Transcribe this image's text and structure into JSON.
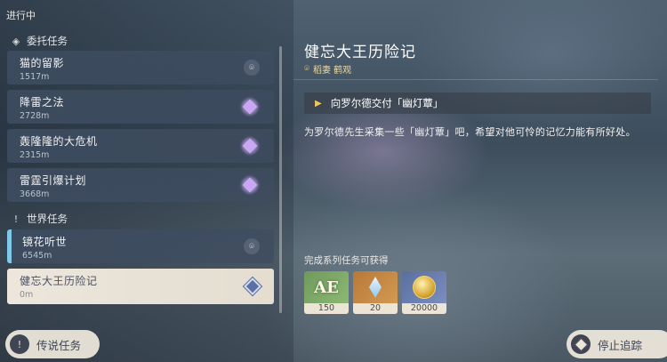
{
  "status_label": "进行中",
  "sections": {
    "commission": "委托任务",
    "world": "世界任务"
  },
  "quests": [
    {
      "name": "猫的留影",
      "distance": "1517m",
      "icon": "map-pin-icon"
    },
    {
      "name": "降雷之法",
      "distance": "2728m",
      "icon": "purple-star-icon"
    },
    {
      "name": "轰隆隆的大危机",
      "distance": "2315m",
      "icon": "purple-star-icon"
    },
    {
      "name": "雷霆引爆计划",
      "distance": "3668m",
      "icon": "purple-star-icon"
    },
    {
      "name": "镜花听世",
      "distance": "6545m",
      "icon": "map-pin-icon"
    },
    {
      "name": "健忘大王历险记",
      "distance": "0m",
      "icon": "tracked-diamond-icon"
    }
  ],
  "detail": {
    "title": "健忘大王历险记",
    "location": "稻妻 鹤观",
    "objective": "向罗尔德交付「幽灯蕈」",
    "description": "为罗尔德先生采集一些「幽灯蕈」吧，希望对他可怜的记忆力能有所好处。",
    "rewards_label": "完成系列任务可获得",
    "rewards": [
      {
        "name": "冒险阅历",
        "count": "150",
        "icon": "adventure-exp-icon"
      },
      {
        "name": "经验",
        "count": "20",
        "icon": "exp-crystal-icon"
      },
      {
        "name": "摩拉",
        "count": "20000",
        "icon": "mora-coin-icon"
      }
    ]
  },
  "buttons": {
    "legend": "传说任务",
    "stop_tracking": "停止追踪"
  },
  "colors": {
    "selected_bg": "#ece6dc",
    "tracked_accent": "#7ec8ea",
    "objective_arrow": "#f0c65c"
  }
}
